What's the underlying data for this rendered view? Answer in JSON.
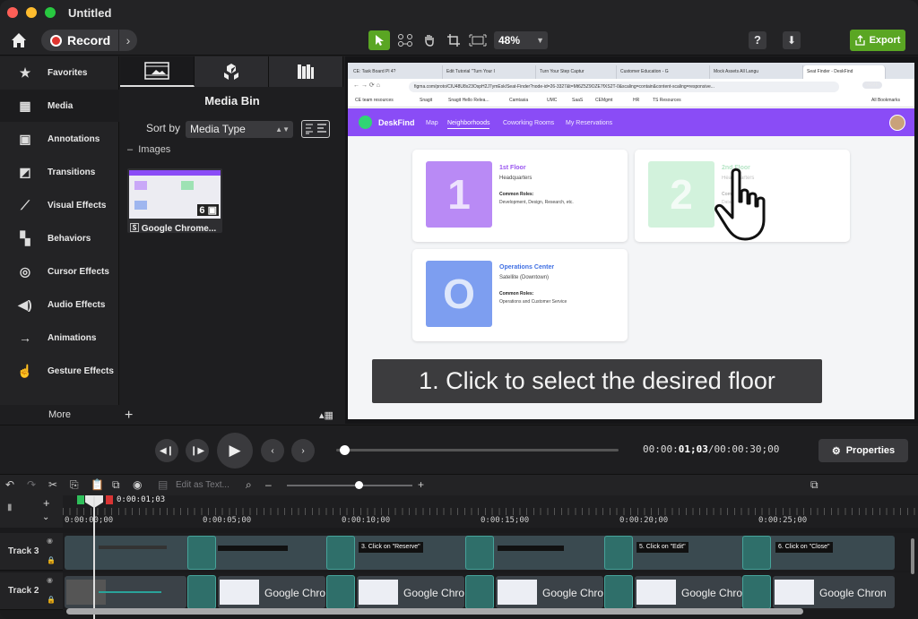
{
  "window": {
    "title": "Untitled"
  },
  "toolbar": {
    "record_label": "Record",
    "zoom": "48%",
    "help": "?",
    "export_label": "Export"
  },
  "leftnav": {
    "items": [
      {
        "label": "Favorites",
        "icon": "star-icon"
      },
      {
        "label": "Media",
        "icon": "film-icon"
      },
      {
        "label": "Annotations",
        "icon": "annotation-icon"
      },
      {
        "label": "Transitions",
        "icon": "transition-icon"
      },
      {
        "label": "Visual Effects",
        "icon": "magic-wand-icon"
      },
      {
        "label": "Behaviors",
        "icon": "behaviors-icon"
      },
      {
        "label": "Cursor Effects",
        "icon": "cursor-icon"
      },
      {
        "label": "Audio Effects",
        "icon": "speaker-icon"
      },
      {
        "label": "Animations",
        "icon": "animation-arrow-icon"
      },
      {
        "label": "Gesture Effects",
        "icon": "hand-gesture-icon"
      }
    ],
    "more": "More"
  },
  "media_bin": {
    "title": "Media Bin",
    "sort_label": "Sort by",
    "sort_value": "Media Type",
    "group_label": "Images",
    "item": {
      "caption": "Google Chrome...",
      "count": "6"
    }
  },
  "browser": {
    "tabs": [
      "CE: Task Board Pl 4?",
      "Edit Tutorial \"Turn Your I",
      "Turn Your Step Captur",
      "Customer Education - G",
      "Mock Assets All Langu",
      "Seat Finder - DeskFind"
    ],
    "url": "figma.com/proto/CIU48U8x23OspH2J7ymEsk/Seat-Finder?node-id=26-3327&t=Mt6Z5Z9OZE7fXS2T-0&scaling=contain&content-scaling=responsive...",
    "bookmarks": [
      "CE team resources",
      "Snagit",
      "Snagit Hello Relea...",
      "Camtasia",
      "UMC",
      "SaaS",
      "CEMgmt",
      "HR",
      "TS Resources",
      "All Bookmarks"
    ],
    "profile": "Work"
  },
  "app": {
    "name": "DeskFind",
    "nav": [
      "Map",
      "Neighborhoods",
      "Coworking Rooms",
      "My Reservations"
    ],
    "cards": [
      {
        "number": "1",
        "name": "1st Floor",
        "sub": "Headquarters",
        "roles_h": "Common Roles:",
        "roles": "Development, Design, Research, etc."
      },
      {
        "number": "2",
        "name": "2nd Floor",
        "sub": "Headquarters",
        "roles_h": "Common Roles:",
        "roles": "Data Science, etc."
      },
      {
        "number": "O",
        "name": "Operations Center",
        "sub": "Satellite (Downtown)",
        "roles_h": "Common Roles:",
        "roles": "Operations and Customer Service"
      }
    ]
  },
  "callout": "1. Click to select the desired floor",
  "playback": {
    "time_prefix": "00:00:",
    "time_current": "01;03",
    "time_total": "/00:00:30;00",
    "properties_label": "Properties"
  },
  "timeline_toolbar": {
    "edit_as_text": "Edit as Text..."
  },
  "timeline": {
    "playhead_time": "0:00:01;03",
    "ruler_labels": [
      "0:00:00;00",
      "0:00:05;00",
      "0:00:10;00",
      "0:00:15;00",
      "0:00:20;00",
      "0:00:25;00"
    ],
    "tracks": [
      {
        "label": "Track 3"
      },
      {
        "label": "Track 2"
      }
    ],
    "track3_texts": [
      "3. Click on \"Reserve\"",
      "5. Click on \"Edit\"",
      "6. Click on \"Close\""
    ],
    "track2_caption": "Google Chron"
  },
  "colors": {
    "accent_green": "#5aa623",
    "app_purple": "#8a4cf6",
    "record_red": "#e0342f"
  }
}
